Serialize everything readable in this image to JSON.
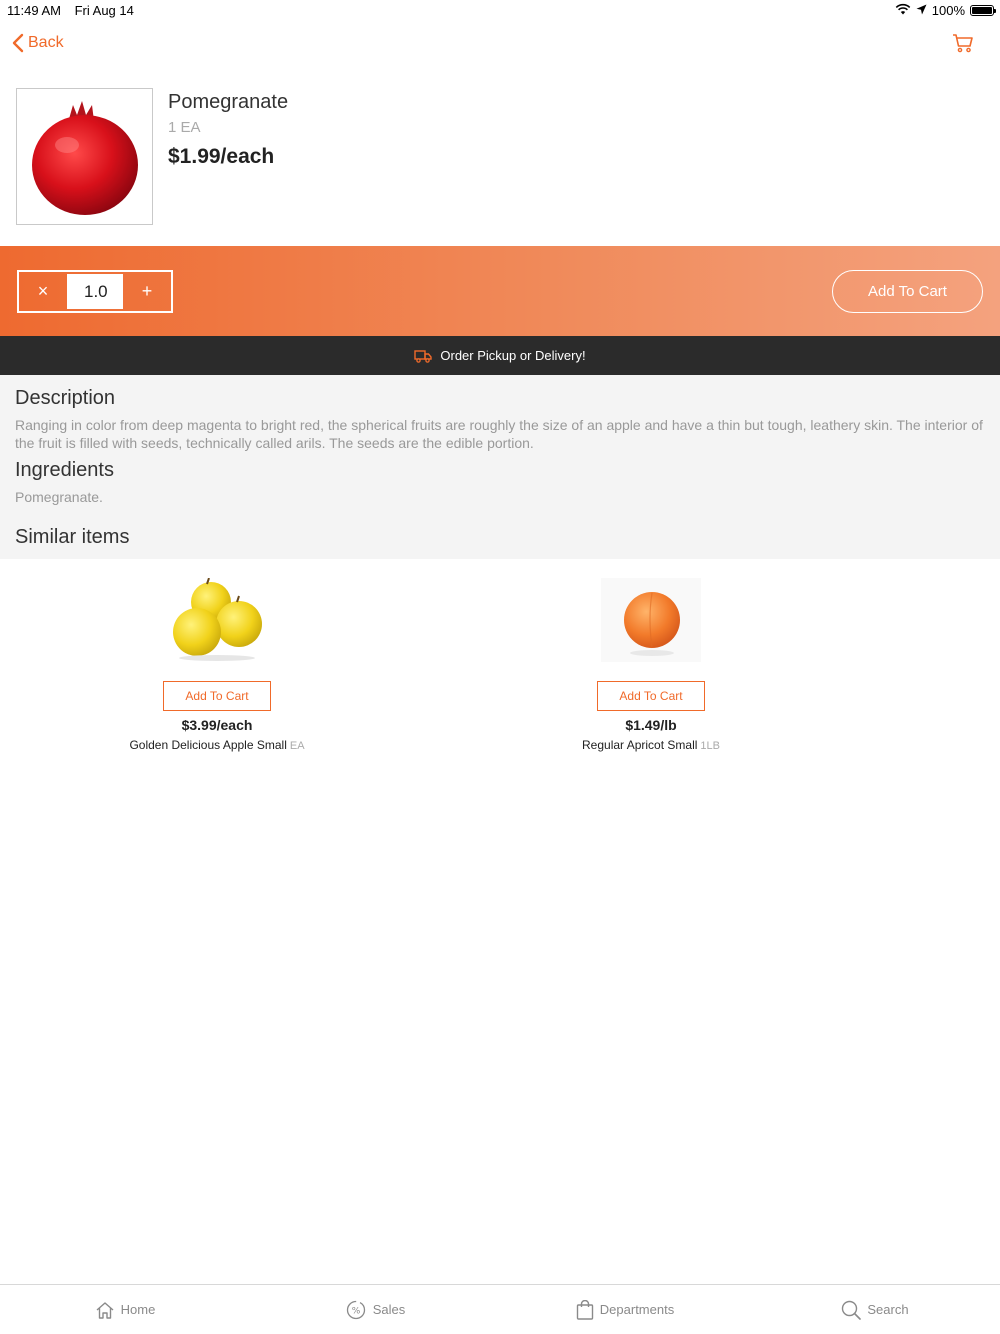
{
  "status_bar": {
    "time": "11:49 AM",
    "date": "Fri Aug 14",
    "battery": "100%",
    "battery_level": 1.0
  },
  "nav": {
    "back_label": "Back",
    "cart_icon": "cart-icon"
  },
  "product": {
    "name": "Pomegranate",
    "unit": "1 EA",
    "price": "$1.99/each",
    "image_icon": "pomegranate-image"
  },
  "quantity": {
    "value": "1.0",
    "decrement_label": "×",
    "increment_label": "+",
    "add_to_cart_label": "Add To Cart"
  },
  "pickup": {
    "label": "Order Pickup or Delivery!",
    "icon": "truck-icon"
  },
  "details": {
    "description_heading": "Description",
    "description_text": "Ranging in color from deep magenta to bright red, the spherical fruits are roughly the size of an apple and have a thin but tough, leathery skin. The interior of the fruit is filled with seeds, technically called arils. The seeds are the edible portion.",
    "ingredients_heading": "Ingredients",
    "ingredients_text": "Pomegranate.",
    "similar_heading": "Similar items"
  },
  "similar_items": [
    {
      "name": "Golden Delicious Apple Small",
      "unit": "EA",
      "price": "$3.99/each",
      "add_label": "Add To Cart",
      "image_icon": "yellow-apples-image"
    },
    {
      "name": "Regular Apricot Small",
      "unit": "1LB",
      "price": "$1.49/lb",
      "add_label": "Add To Cart",
      "image_icon": "apricot-image"
    }
  ],
  "tabs": [
    {
      "label": "Home",
      "icon": "home-icon"
    },
    {
      "label": "Sales",
      "icon": "sales-icon"
    },
    {
      "label": "Departments",
      "icon": "shopping-bag-icon"
    },
    {
      "label": "Search",
      "icon": "search-icon"
    }
  ],
  "colors": {
    "accent": "#f06a2a",
    "pickup_bar": "#2b2b2b",
    "details_bg": "#f4f4f4"
  }
}
